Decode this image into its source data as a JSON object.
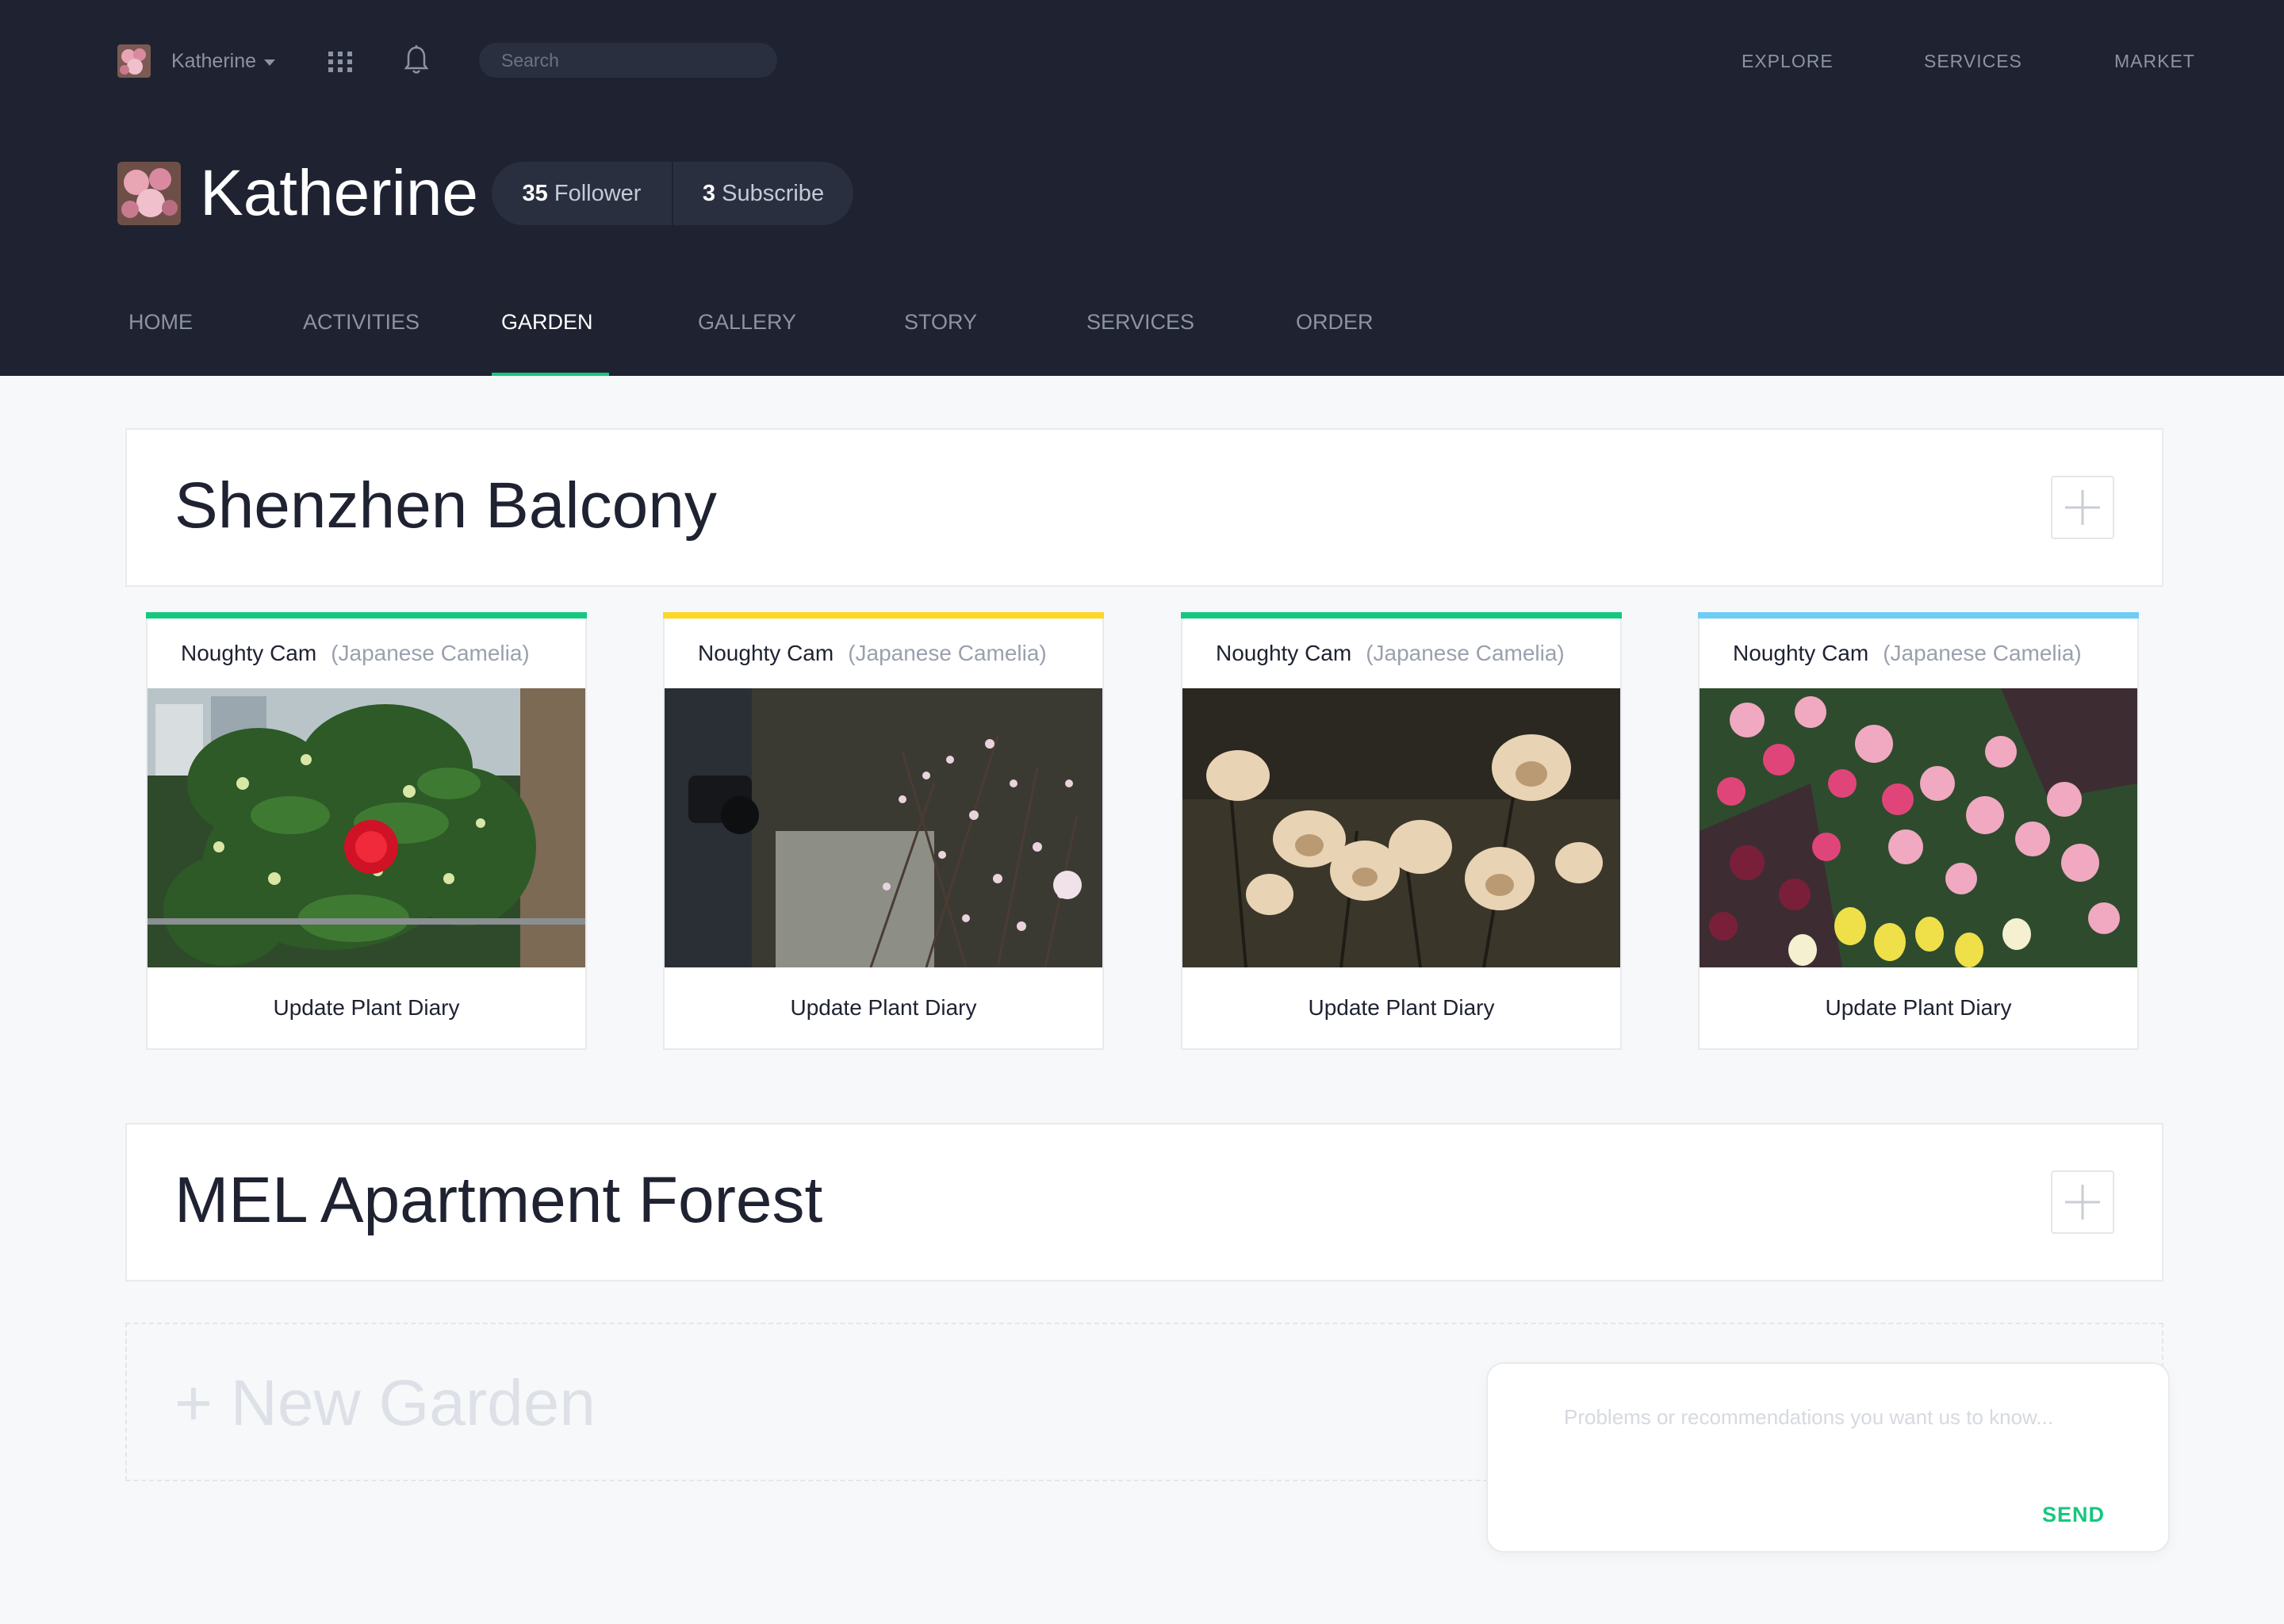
{
  "topbar": {
    "username": "Katherine",
    "search_placeholder": "Search",
    "nav": [
      "EXPLORE",
      "SERVICES",
      "MARKET"
    ]
  },
  "profile": {
    "name": "Katherine",
    "followers_count": "35",
    "followers_label": "Follower",
    "subscribe_count": "3",
    "subscribe_label": "Subscribe"
  },
  "tabs": [
    "HOME",
    "ACTIVITIES",
    "GARDEN",
    "GALLERY",
    "STORY",
    "SERVICES",
    "ORDER"
  ],
  "active_tab": "GARDEN",
  "gardens": [
    {
      "title": "Shenzhen Balcony",
      "plants": [
        {
          "name": "Noughty Cam",
          "species": "(Japanese Camelia)",
          "action": "Update Plant Diary",
          "accent": "#17c77f"
        },
        {
          "name": "Noughty Cam",
          "species": "(Japanese Camelia)",
          "action": "Update Plant Diary",
          "accent": "#fdd626"
        },
        {
          "name": "Noughty Cam",
          "species": "(Japanese Camelia)",
          "action": "Update Plant Diary",
          "accent": "#17c77f"
        },
        {
          "name": "Noughty Cam",
          "species": "(Japanese Camelia)",
          "action": "Update Plant Diary",
          "accent": "#6dcdf5"
        }
      ]
    },
    {
      "title": "MEL Apartment Forest",
      "plants": []
    }
  ],
  "new_garden_label": "+ New Garden",
  "feedback": {
    "placeholder": "Problems or recommendations you want us to know...",
    "send_label": "SEND"
  },
  "colors": {
    "header_bg": "#1e2231",
    "accent_green": "#17c77f",
    "accent_yellow": "#fdd626",
    "accent_blue": "#6dcdf5"
  }
}
